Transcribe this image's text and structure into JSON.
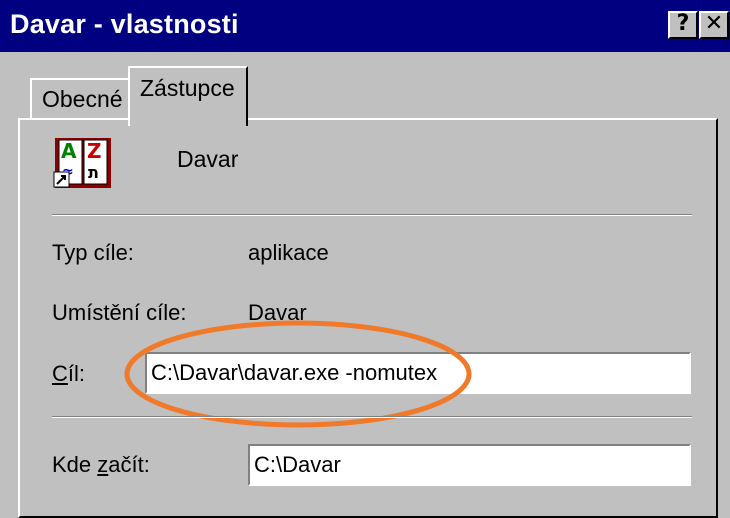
{
  "window": {
    "title": "Davar - vlastnosti",
    "help_label": "?",
    "close_label": "✕"
  },
  "tabs": [
    {
      "label": "Obecné",
      "selected": false
    },
    {
      "label": "Zástupce",
      "selected": true
    }
  ],
  "shortcut": {
    "icon": "dictionary-shortcut-icon",
    "name": "Davar",
    "target_type_label": "Typ cíle:",
    "target_type_value": "aplikace",
    "target_location_label": "Umístění cíle:",
    "target_location_value": "Davar",
    "target_label_u": "C",
    "target_label_rest": "íl:",
    "target_value": "C:\\Davar\\davar.exe -nomutex",
    "start_in_label_a": "Kde ",
    "start_in_label_u": "z",
    "start_in_label_b": "ačít:",
    "start_in_value": "C:\\Davar"
  },
  "colors": {
    "titlebar": "#000080",
    "face": "#c0c0c0",
    "highlight_ellipse": "#f07a2a"
  }
}
